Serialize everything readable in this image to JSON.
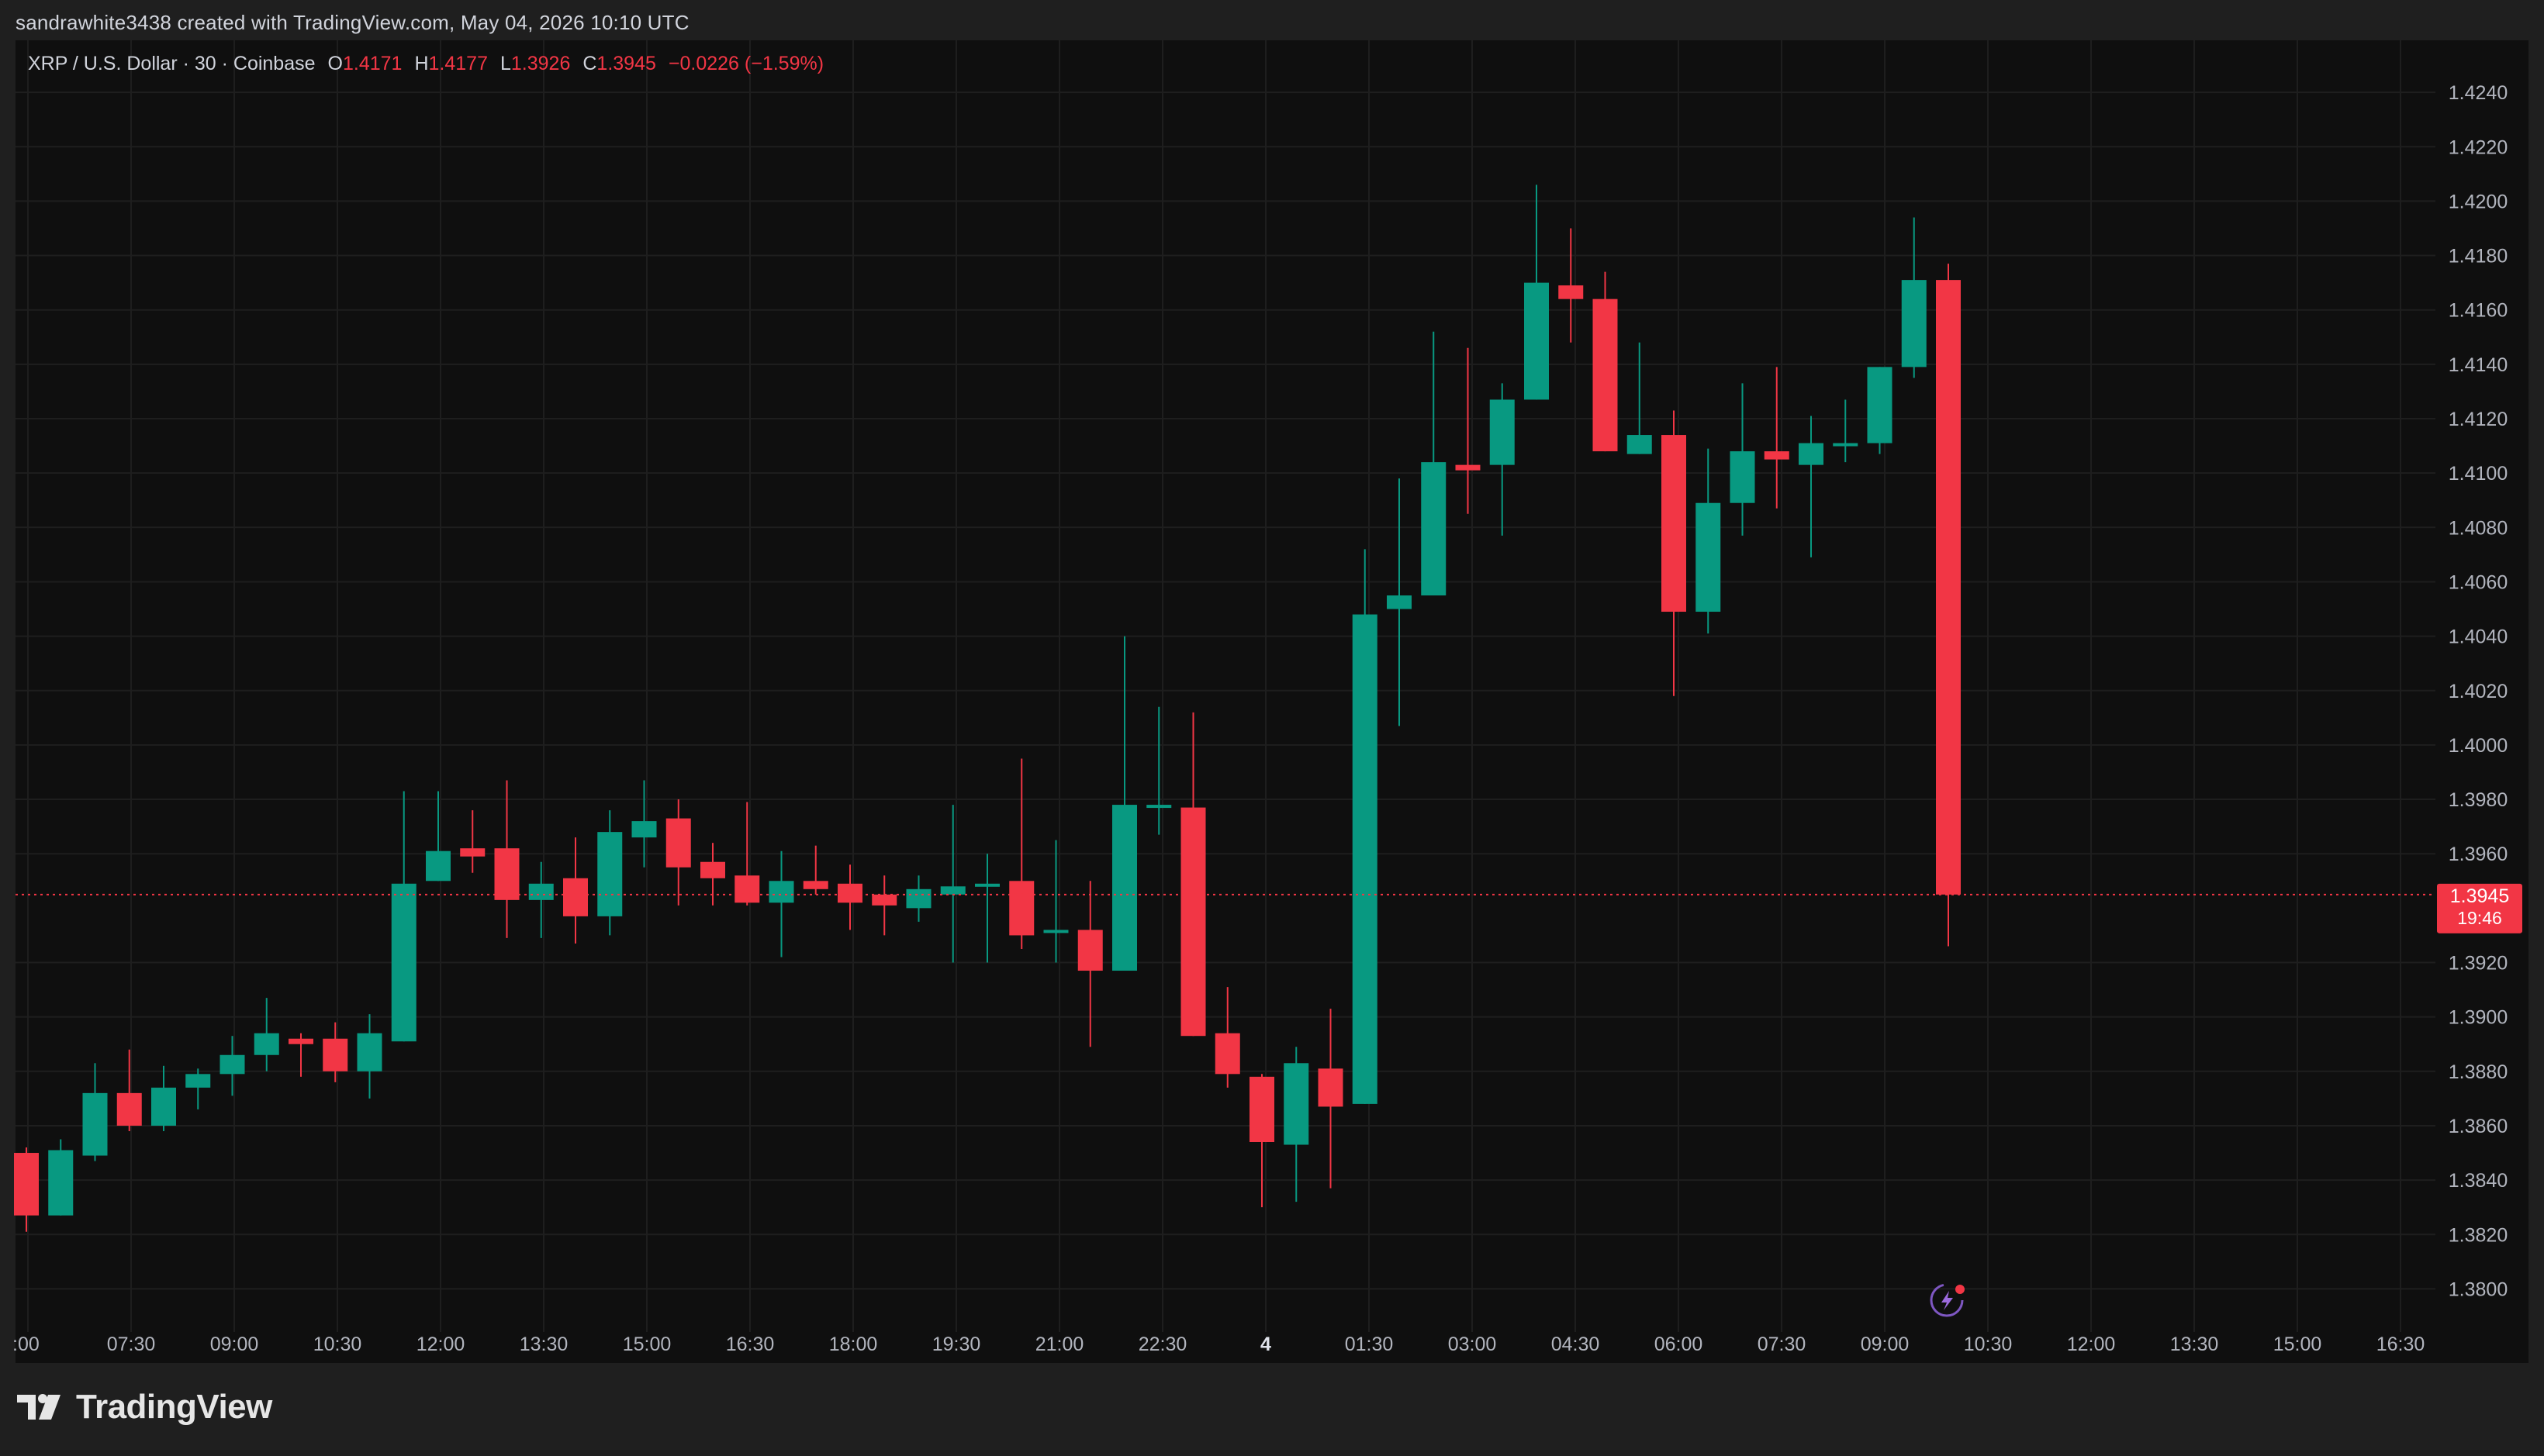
{
  "header": {
    "attribution": "sandrawhite3438 created with TradingView.com, May 04, 2026 10:10 UTC"
  },
  "legend": {
    "symbol": "XRP / U.S. Dollar · 30 · Coinbase",
    "o_label": "O",
    "o_value": "1.4171",
    "h_label": "H",
    "h_value": "1.4177",
    "l_label": "L",
    "l_value": "1.3926",
    "c_label": "C",
    "c_value": "1.3945",
    "change": "−0.0226 (−1.59%)"
  },
  "price_tag": {
    "price": "1.3945",
    "countdown": "19:46"
  },
  "footer": {
    "brand": "TradingView"
  },
  "colors": {
    "up": "#089981",
    "down": "#f23645",
    "background": "#0f0f0f",
    "frame": "#1f1f1f",
    "grid": "#1e1e1e",
    "text": "#d1d4dc",
    "axis_text": "#b2b5be"
  },
  "icons": {
    "replay": "lightning-replay-icon",
    "logo": "tradingview-logo-icon"
  },
  "chart_data": {
    "type": "candlestick",
    "title": "XRP / U.S. Dollar · 30 · Coinbase",
    "interval": "30",
    "ylim": [
      1.3787,
      1.4254
    ],
    "y_ticks": [
      "1.4240",
      "1.4220",
      "1.4200",
      "1.4180",
      "1.4160",
      "1.4140",
      "1.4120",
      "1.4100",
      "1.4080",
      "1.4060",
      "1.4040",
      "1.4020",
      "1.4000",
      "1.3980",
      "1.3960",
      "1.3920",
      "1.3900",
      "1.3880",
      "1.3860",
      "1.3840",
      "1.3820",
      "1.3800"
    ],
    "x_ticks": [
      ":00",
      "07:30",
      "09:00",
      "10:30",
      "12:00",
      "13:30",
      "15:00",
      "16:30",
      "18:00",
      "19:30",
      "21:00",
      "22:30",
      "4",
      "01:30",
      "03:00",
      "04:30",
      "06:00",
      "07:30",
      "09:00",
      "10:30",
      "12:00",
      "13:30",
      "15:00",
      "16:30"
    ],
    "grid": true,
    "last_price": 1.3945,
    "candles": [
      {
        "o": 1.385,
        "h": 1.3852,
        "l": 1.3821,
        "c": 1.3827
      },
      {
        "o": 1.3827,
        "h": 1.3855,
        "l": 1.3827,
        "c": 1.3851
      },
      {
        "o": 1.3849,
        "h": 1.3883,
        "l": 1.3847,
        "c": 1.3872
      },
      {
        "o": 1.3872,
        "h": 1.3888,
        "l": 1.3858,
        "c": 1.386
      },
      {
        "o": 1.386,
        "h": 1.3882,
        "l": 1.3858,
        "c": 1.3874
      },
      {
        "o": 1.3874,
        "h": 1.3881,
        "l": 1.3866,
        "c": 1.3879
      },
      {
        "o": 1.3879,
        "h": 1.3893,
        "l": 1.3871,
        "c": 1.3886
      },
      {
        "o": 1.3886,
        "h": 1.3907,
        "l": 1.388,
        "c": 1.3894
      },
      {
        "o": 1.3892,
        "h": 1.3894,
        "l": 1.3878,
        "c": 1.389
      },
      {
        "o": 1.3892,
        "h": 1.3898,
        "l": 1.3876,
        "c": 1.388
      },
      {
        "o": 1.388,
        "h": 1.3901,
        "l": 1.387,
        "c": 1.3894
      },
      {
        "o": 1.3891,
        "h": 1.3983,
        "l": 1.3891,
        "c": 1.3949
      },
      {
        "o": 1.395,
        "h": 1.3983,
        "l": 1.395,
        "c": 1.3961
      },
      {
        "o": 1.3962,
        "h": 1.3976,
        "l": 1.3953,
        "c": 1.3959
      },
      {
        "o": 1.3962,
        "h": 1.3987,
        "l": 1.3929,
        "c": 1.3943
      },
      {
        "o": 1.3943,
        "h": 1.3957,
        "l": 1.3929,
        "c": 1.3949
      },
      {
        "o": 1.3951,
        "h": 1.3966,
        "l": 1.3927,
        "c": 1.3937
      },
      {
        "o": 1.3937,
        "h": 1.3976,
        "l": 1.393,
        "c": 1.3968
      },
      {
        "o": 1.3966,
        "h": 1.3987,
        "l": 1.3955,
        "c": 1.3972
      },
      {
        "o": 1.3973,
        "h": 1.398,
        "l": 1.3941,
        "c": 1.3955
      },
      {
        "o": 1.3957,
        "h": 1.3964,
        "l": 1.3941,
        "c": 1.3951
      },
      {
        "o": 1.3952,
        "h": 1.3979,
        "l": 1.3941,
        "c": 1.3942
      },
      {
        "o": 1.3942,
        "h": 1.3961,
        "l": 1.3922,
        "c": 1.395
      },
      {
        "o": 1.395,
        "h": 1.3963,
        "l": 1.3945,
        "c": 1.3947
      },
      {
        "o": 1.3949,
        "h": 1.3956,
        "l": 1.3932,
        "c": 1.3942
      },
      {
        "o": 1.3945,
        "h": 1.3952,
        "l": 1.393,
        "c": 1.3941
      },
      {
        "o": 1.394,
        "h": 1.3952,
        "l": 1.3935,
        "c": 1.3947
      },
      {
        "o": 1.3945,
        "h": 1.3978,
        "l": 1.392,
        "c": 1.3948
      },
      {
        "o": 1.3948,
        "h": 1.396,
        "l": 1.392,
        "c": 1.3949
      },
      {
        "o": 1.395,
        "h": 1.3995,
        "l": 1.3925,
        "c": 1.393
      },
      {
        "o": 1.3932,
        "h": 1.3965,
        "l": 1.392,
        "c": 1.3932
      },
      {
        "o": 1.3932,
        "h": 1.395,
        "l": 1.3889,
        "c": 1.3917
      },
      {
        "o": 1.3917,
        "h": 1.404,
        "l": 1.3917,
        "c": 1.3978
      },
      {
        "o": 1.3978,
        "h": 1.4014,
        "l": 1.3967,
        "c": 1.3978
      },
      {
        "o": 1.3977,
        "h": 1.4012,
        "l": 1.3893,
        "c": 1.3893
      },
      {
        "o": 1.3894,
        "h": 1.3911,
        "l": 1.3874,
        "c": 1.3879
      },
      {
        "o": 1.3878,
        "h": 1.3879,
        "l": 1.383,
        "c": 1.3854
      },
      {
        "o": 1.3853,
        "h": 1.3889,
        "l": 1.3832,
        "c": 1.3883
      },
      {
        "o": 1.3881,
        "h": 1.3903,
        "l": 1.3837,
        "c": 1.3867
      },
      {
        "o": 1.3868,
        "h": 1.4072,
        "l": 1.3868,
        "c": 1.4048
      },
      {
        "o": 1.405,
        "h": 1.4098,
        "l": 1.4007,
        "c": 1.4055
      },
      {
        "o": 1.4055,
        "h": 1.4152,
        "l": 1.4055,
        "c": 1.4104
      },
      {
        "o": 1.4103,
        "h": 1.4146,
        "l": 1.4085,
        "c": 1.4101
      },
      {
        "o": 1.4103,
        "h": 1.4133,
        "l": 1.4077,
        "c": 1.4127
      },
      {
        "o": 1.4127,
        "h": 1.4206,
        "l": 1.4127,
        "c": 1.417
      },
      {
        "o": 1.4169,
        "h": 1.419,
        "l": 1.4148,
        "c": 1.4164
      },
      {
        "o": 1.4164,
        "h": 1.4174,
        "l": 1.4108,
        "c": 1.4108
      },
      {
        "o": 1.4107,
        "h": 1.4148,
        "l": 1.4107,
        "c": 1.4114
      },
      {
        "o": 1.4114,
        "h": 1.4123,
        "l": 1.4018,
        "c": 1.4049
      },
      {
        "o": 1.4049,
        "h": 1.4109,
        "l": 1.4041,
        "c": 1.4089
      },
      {
        "o": 1.4089,
        "h": 1.4133,
        "l": 1.4077,
        "c": 1.4108
      },
      {
        "o": 1.4108,
        "h": 1.4139,
        "l": 1.4087,
        "c": 1.4105
      },
      {
        "o": 1.4103,
        "h": 1.4121,
        "l": 1.4069,
        "c": 1.4111
      },
      {
        "o": 1.411,
        "h": 1.4127,
        "l": 1.4104,
        "c": 1.4111
      },
      {
        "o": 1.4111,
        "h": 1.4139,
        "l": 1.4107,
        "c": 1.4139
      },
      {
        "o": 1.4139,
        "h": 1.4194,
        "l": 1.4135,
        "c": 1.4171
      },
      {
        "o": 1.4171,
        "h": 1.4177,
        "l": 1.3926,
        "c": 1.3945
      }
    ]
  }
}
